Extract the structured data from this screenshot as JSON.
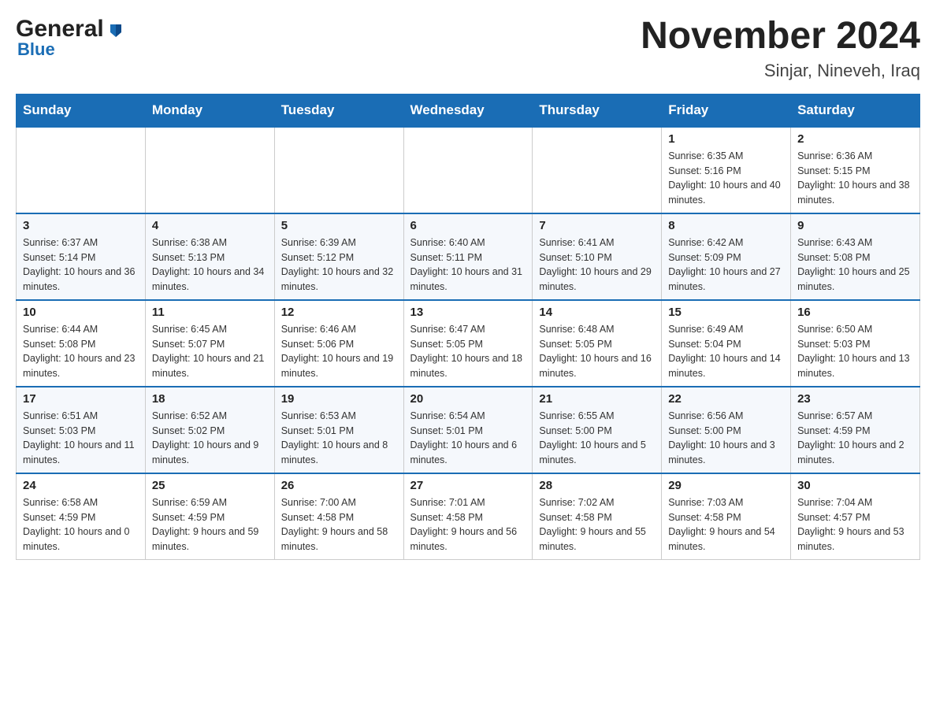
{
  "header": {
    "logo_general": "General",
    "logo_blue": "Blue",
    "month_title": "November 2024",
    "location": "Sinjar, Nineveh, Iraq"
  },
  "days_of_week": [
    "Sunday",
    "Monday",
    "Tuesday",
    "Wednesday",
    "Thursday",
    "Friday",
    "Saturday"
  ],
  "weeks": [
    [
      {
        "day": "",
        "info": ""
      },
      {
        "day": "",
        "info": ""
      },
      {
        "day": "",
        "info": ""
      },
      {
        "day": "",
        "info": ""
      },
      {
        "day": "",
        "info": ""
      },
      {
        "day": "1",
        "info": "Sunrise: 6:35 AM\nSunset: 5:16 PM\nDaylight: 10 hours and 40 minutes."
      },
      {
        "day": "2",
        "info": "Sunrise: 6:36 AM\nSunset: 5:15 PM\nDaylight: 10 hours and 38 minutes."
      }
    ],
    [
      {
        "day": "3",
        "info": "Sunrise: 6:37 AM\nSunset: 5:14 PM\nDaylight: 10 hours and 36 minutes."
      },
      {
        "day": "4",
        "info": "Sunrise: 6:38 AM\nSunset: 5:13 PM\nDaylight: 10 hours and 34 minutes."
      },
      {
        "day": "5",
        "info": "Sunrise: 6:39 AM\nSunset: 5:12 PM\nDaylight: 10 hours and 32 minutes."
      },
      {
        "day": "6",
        "info": "Sunrise: 6:40 AM\nSunset: 5:11 PM\nDaylight: 10 hours and 31 minutes."
      },
      {
        "day": "7",
        "info": "Sunrise: 6:41 AM\nSunset: 5:10 PM\nDaylight: 10 hours and 29 minutes."
      },
      {
        "day": "8",
        "info": "Sunrise: 6:42 AM\nSunset: 5:09 PM\nDaylight: 10 hours and 27 minutes."
      },
      {
        "day": "9",
        "info": "Sunrise: 6:43 AM\nSunset: 5:08 PM\nDaylight: 10 hours and 25 minutes."
      }
    ],
    [
      {
        "day": "10",
        "info": "Sunrise: 6:44 AM\nSunset: 5:08 PM\nDaylight: 10 hours and 23 minutes."
      },
      {
        "day": "11",
        "info": "Sunrise: 6:45 AM\nSunset: 5:07 PM\nDaylight: 10 hours and 21 minutes."
      },
      {
        "day": "12",
        "info": "Sunrise: 6:46 AM\nSunset: 5:06 PM\nDaylight: 10 hours and 19 minutes."
      },
      {
        "day": "13",
        "info": "Sunrise: 6:47 AM\nSunset: 5:05 PM\nDaylight: 10 hours and 18 minutes."
      },
      {
        "day": "14",
        "info": "Sunrise: 6:48 AM\nSunset: 5:05 PM\nDaylight: 10 hours and 16 minutes."
      },
      {
        "day": "15",
        "info": "Sunrise: 6:49 AM\nSunset: 5:04 PM\nDaylight: 10 hours and 14 minutes."
      },
      {
        "day": "16",
        "info": "Sunrise: 6:50 AM\nSunset: 5:03 PM\nDaylight: 10 hours and 13 minutes."
      }
    ],
    [
      {
        "day": "17",
        "info": "Sunrise: 6:51 AM\nSunset: 5:03 PM\nDaylight: 10 hours and 11 minutes."
      },
      {
        "day": "18",
        "info": "Sunrise: 6:52 AM\nSunset: 5:02 PM\nDaylight: 10 hours and 9 minutes."
      },
      {
        "day": "19",
        "info": "Sunrise: 6:53 AM\nSunset: 5:01 PM\nDaylight: 10 hours and 8 minutes."
      },
      {
        "day": "20",
        "info": "Sunrise: 6:54 AM\nSunset: 5:01 PM\nDaylight: 10 hours and 6 minutes."
      },
      {
        "day": "21",
        "info": "Sunrise: 6:55 AM\nSunset: 5:00 PM\nDaylight: 10 hours and 5 minutes."
      },
      {
        "day": "22",
        "info": "Sunrise: 6:56 AM\nSunset: 5:00 PM\nDaylight: 10 hours and 3 minutes."
      },
      {
        "day": "23",
        "info": "Sunrise: 6:57 AM\nSunset: 4:59 PM\nDaylight: 10 hours and 2 minutes."
      }
    ],
    [
      {
        "day": "24",
        "info": "Sunrise: 6:58 AM\nSunset: 4:59 PM\nDaylight: 10 hours and 0 minutes."
      },
      {
        "day": "25",
        "info": "Sunrise: 6:59 AM\nSunset: 4:59 PM\nDaylight: 9 hours and 59 minutes."
      },
      {
        "day": "26",
        "info": "Sunrise: 7:00 AM\nSunset: 4:58 PM\nDaylight: 9 hours and 58 minutes."
      },
      {
        "day": "27",
        "info": "Sunrise: 7:01 AM\nSunset: 4:58 PM\nDaylight: 9 hours and 56 minutes."
      },
      {
        "day": "28",
        "info": "Sunrise: 7:02 AM\nSunset: 4:58 PM\nDaylight: 9 hours and 55 minutes."
      },
      {
        "day": "29",
        "info": "Sunrise: 7:03 AM\nSunset: 4:58 PM\nDaylight: 9 hours and 54 minutes."
      },
      {
        "day": "30",
        "info": "Sunrise: 7:04 AM\nSunset: 4:57 PM\nDaylight: 9 hours and 53 minutes."
      }
    ]
  ]
}
